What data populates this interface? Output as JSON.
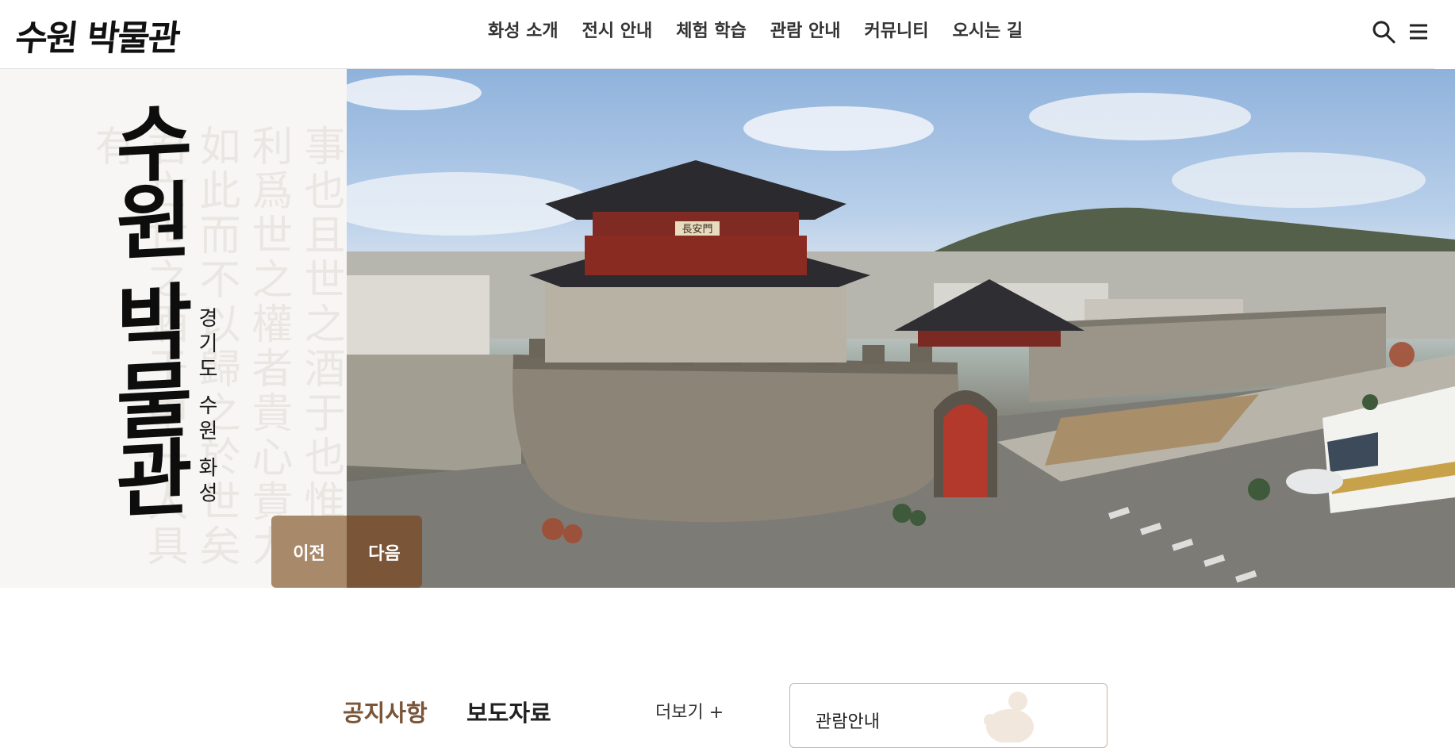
{
  "header": {
    "logo": "수원 박물관",
    "nav": [
      "화성 소개",
      "전시 안내",
      "체험 학습",
      "관람 안내",
      "커뮤니티",
      "오시는 길"
    ]
  },
  "hero": {
    "title": "수원 박물관",
    "subtitle": "경기도 수원 화성",
    "prev_label": "이전",
    "next_label": "다음",
    "gate_sign": "長安門"
  },
  "notice": {
    "tabs": [
      "공지사항",
      "보도자료"
    ],
    "more_label": "더보기 +"
  },
  "info_card": {
    "title": "관람안내"
  },
  "colors": {
    "accent_brown": "#7a5538",
    "light_brown": "#a8896a",
    "card_border": "#c9b49e"
  }
}
